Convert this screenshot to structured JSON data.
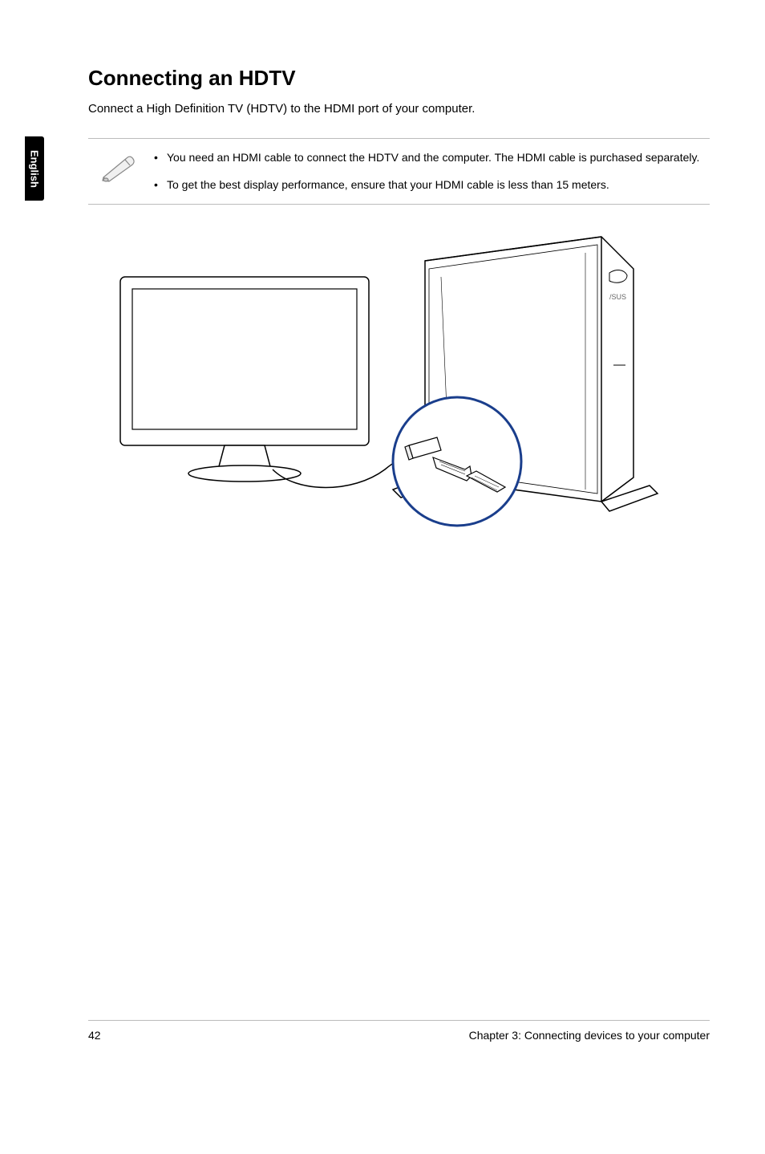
{
  "side_tab": "English",
  "heading": "Connecting an HDTV",
  "intro": "Connect a High Definition TV (HDTV) to the HDMI port of your computer.",
  "notes": {
    "bullet1": "You need an HDMI cable to connect the HDTV and the computer. The HDMI cable is purchased separately.",
    "bullet2": "To get the best display performance, ensure that your HDMI cable is less than 15 meters."
  },
  "footer": {
    "page_number": "42",
    "chapter": "Chapter 3: Connecting devices to your computer"
  }
}
